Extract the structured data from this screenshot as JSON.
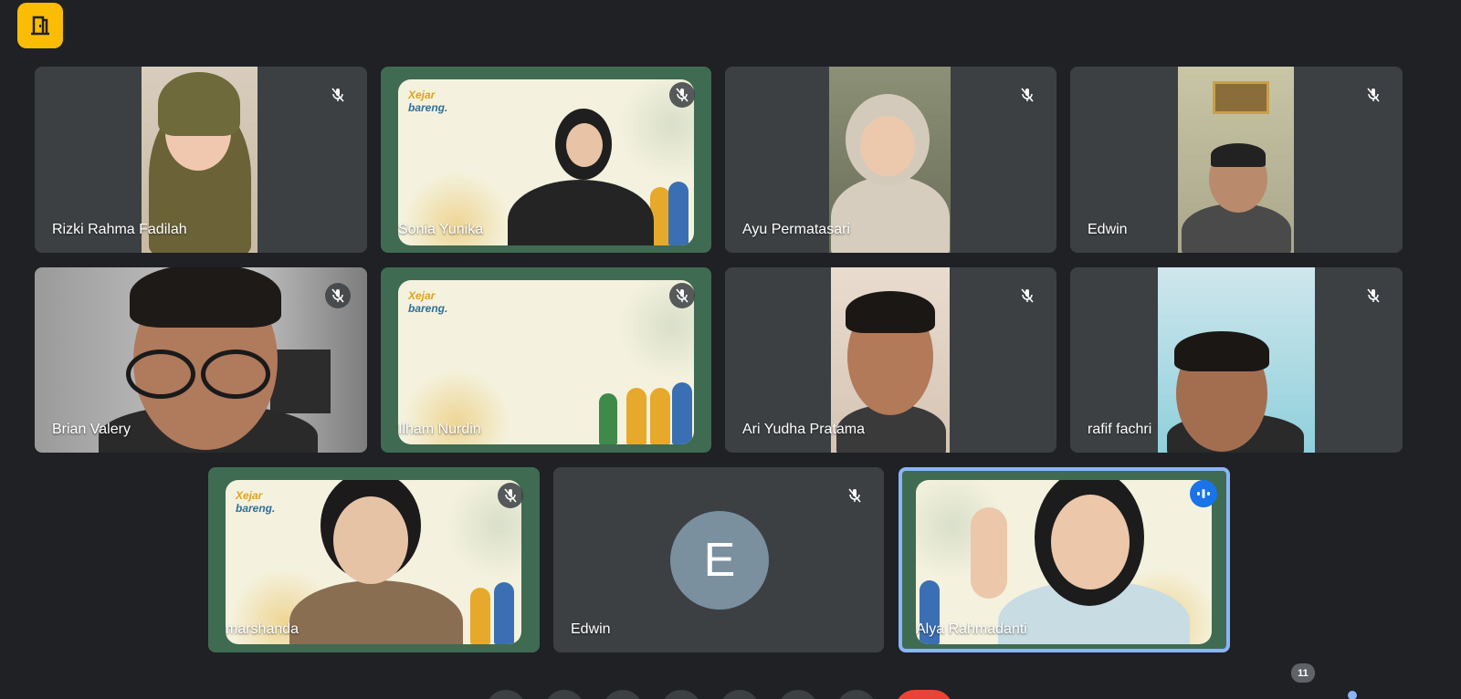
{
  "app": {
    "icon": "meeting-door-icon",
    "accent": "#fbbc04"
  },
  "brand": {
    "line1": "Xejar",
    "line2": "bareng."
  },
  "participants": [
    {
      "name": "Rizki Rahma Fadilah",
      "muted": true
    },
    {
      "name": "Sonia Yunika",
      "muted": true
    },
    {
      "name": "Ayu Permatasari",
      "muted": true
    },
    {
      "name": "Edwin",
      "muted": true
    },
    {
      "name": "Brian Valery",
      "muted": true
    },
    {
      "name": "Ilham Nurdin",
      "muted": true
    },
    {
      "name": "Ari Yudha Pratama",
      "muted": true
    },
    {
      "name": "rafif fachri",
      "muted": true
    },
    {
      "name": "marshanda",
      "muted": true
    },
    {
      "name": "Edwin",
      "muted": true,
      "avatar_letter": "E"
    },
    {
      "name": "Alya Rahmadanti",
      "muted": false,
      "speaking": true
    }
  ],
  "participant_count": "11",
  "colors": {
    "background": "#202124",
    "tile": "#3c4043",
    "active_outline": "#8ab4f8",
    "speaking": "#1a73e8",
    "end_call": "#ea4335"
  }
}
